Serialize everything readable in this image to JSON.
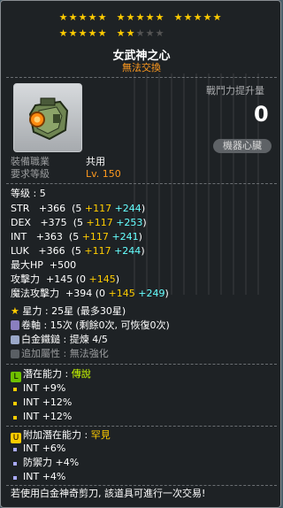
{
  "stars": {
    "filled_count": 22,
    "total": 25,
    "glyph": "★",
    "filled_color": "#ffcc00",
    "empty_color": "#555555"
  },
  "item": {
    "name": "女武神之心",
    "trade_status": "無法交換",
    "power_label": "戰鬥力提升量",
    "power_value": "0",
    "mechanical_heart_button": "機器心臟",
    "job_label": "裝備職業",
    "job_value": "共用",
    "req_level_label": "要求等級",
    "req_level_value": "Lv. 150"
  },
  "stats": {
    "level": "等级 : 5",
    "str": {
      "label": "STR",
      "total": "+366",
      "base": "(5 ",
      "star": "+117",
      "pot": "+244",
      "close": ")"
    },
    "dex": {
      "label": "DEX",
      "total": "+375",
      "base": "(5 ",
      "star": "+117",
      "pot": "+253",
      "close": ")"
    },
    "int": {
      "label": "INT",
      "total": "+363",
      "base": "(5 ",
      "star": "+117",
      "pot": "+241",
      "close": ")"
    },
    "luk": {
      "label": "LUK",
      "total": "+366",
      "base": "(5 ",
      "star": "+117",
      "pot": "+244",
      "close": ")"
    },
    "maxhp": {
      "label": "最大HP",
      "value": "+500"
    },
    "att": {
      "label": "攻擊力",
      "total": "+145",
      "base": "(0 ",
      "star": "+145",
      "close": ")"
    },
    "matt": {
      "label": "魔法攻擊力",
      "total": "+394",
      "base": "(0 ",
      "star": "+145",
      "pot": "+249",
      "close": ")"
    }
  },
  "enhance": {
    "starforce": "星力 : 25星 (最多30星)",
    "scrolls": "卷軸 : 15次 (剩餘0次, 可恢復0次)",
    "hammer_prefix": "白金鐵鎚 : ",
    "hammer_value": "提煉 4/5",
    "additional": "追加屬性 : 無法強化"
  },
  "potential": {
    "header_prefix": "潛在能力 : ",
    "grade": "傳說",
    "lines": [
      "INT +9%",
      "INT +12%",
      "INT +12%"
    ],
    "grade_color": "#ccff00"
  },
  "bonus_potential": {
    "header_prefix": "附加潛在能力 : ",
    "grade": "罕見",
    "lines": [
      "INT +6%",
      "防禦力 +4%",
      "INT +4%"
    ],
    "grade_color": "#ffcc00"
  },
  "footer": "若使用白金神奇剪刀, 該道具可進行一次交易!",
  "colors": {
    "star_bonus": "#ffcc00",
    "potential_bonus": "#66ffff",
    "trade": "#ff9a1f"
  }
}
